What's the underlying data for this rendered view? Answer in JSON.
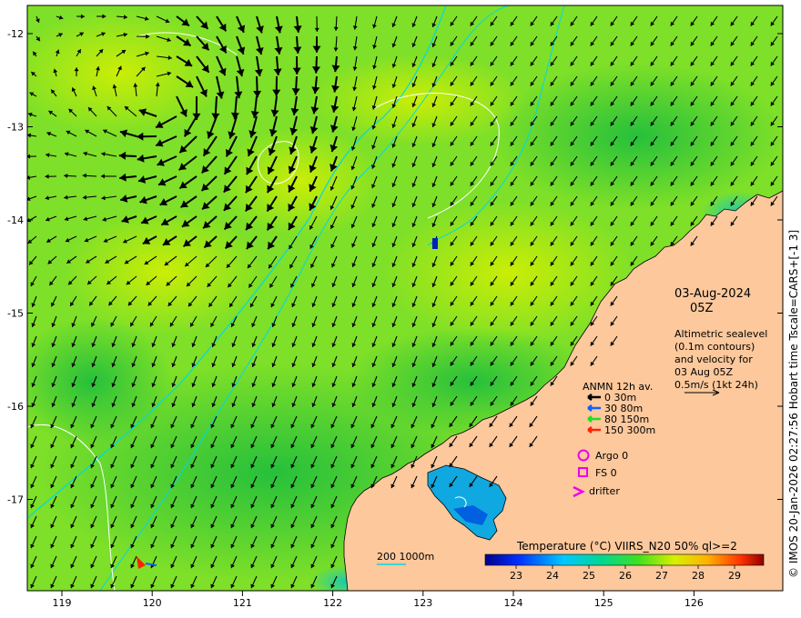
{
  "map": {
    "x_ticks": [
      "119",
      "120",
      "121",
      "122",
      "123",
      "124",
      "125",
      "126"
    ],
    "y_ticks": [
      "-12",
      "-13",
      "-14",
      "-15",
      "-16",
      "-17"
    ],
    "date": "03-Aug-2024",
    "time": "05Z",
    "description_lines": [
      "Altimetric sealevel",
      "(0.1m contours)",
      "and velocity for",
      "03 Aug 05Z",
      "0.5m/s (1kt 24h)"
    ],
    "anmn": {
      "title": "ANMN 12h av.",
      "items": [
        {
          "label": "0 30m",
          "color": "#000000"
        },
        {
          "label": "30 80m",
          "color": "#1060ff"
        },
        {
          "label": "80 150m",
          "color": "#22dd22"
        },
        {
          "label": "150 300m",
          "color": "#ff2200"
        }
      ]
    },
    "markers": [
      {
        "label": "Argo 0",
        "icon": "circle-icon",
        "color": "#ee00ee"
      },
      {
        "label": "FS 0",
        "icon": "square-icon",
        "color": "#ee00ee"
      },
      {
        "label": "drifter",
        "icon": "chevron-icon",
        "color": "#ee00ee"
      }
    ],
    "bathy_label": "200  1000m",
    "colorbar": {
      "title": "Temperature (°C) VIIRS_N20 50% ql>=2",
      "ticks": [
        "23",
        "24",
        "25",
        "26",
        "27",
        "28",
        "29"
      ]
    },
    "credit": "© IMOS 20-Jan-2026 02:27:56 Hobart time Tscale=CARS+[-1 3]",
    "colors": {
      "land": "#fcc89c",
      "isobath": "#00d8e8",
      "contour": "#ffffff"
    }
  }
}
